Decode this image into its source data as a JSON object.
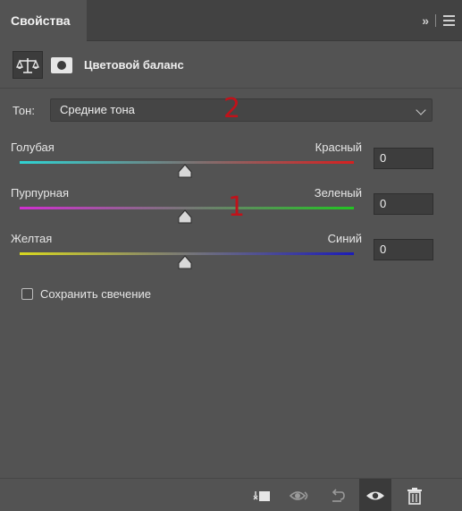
{
  "panel": {
    "tab_title": "Свойства",
    "collapse_glyph": "»"
  },
  "adjustment": {
    "icon": "balance-scale-icon",
    "mask_icon": "layer-mask-icon",
    "title": "Цветовой баланс"
  },
  "tone": {
    "label": "Тон:",
    "selected": "Средние тона"
  },
  "annotations": {
    "marker_2": "2",
    "marker_1": "1"
  },
  "sliders": [
    {
      "left_label": "Голубая",
      "right_label": "Красный",
      "value": "0",
      "left_color": "#2fd3d3",
      "right_color": "#d62020"
    },
    {
      "left_label": "Пурпурная",
      "right_label": "Зеленый",
      "value": "0",
      "left_color": "#d12fd1",
      "right_color": "#22c422"
    },
    {
      "left_label": "Желтая",
      "right_label": "Синий",
      "value": "0",
      "left_color": "#d8d820",
      "right_color": "#1c1cb8"
    }
  ],
  "preserve_luminosity": {
    "label": "Сохранить свечение",
    "checked": false
  },
  "toolbar": {
    "buttons": [
      "clip-to-layer-icon",
      "view-previous-state-icon",
      "reset-icon",
      "visibility-eye-icon",
      "trash-icon"
    ]
  }
}
